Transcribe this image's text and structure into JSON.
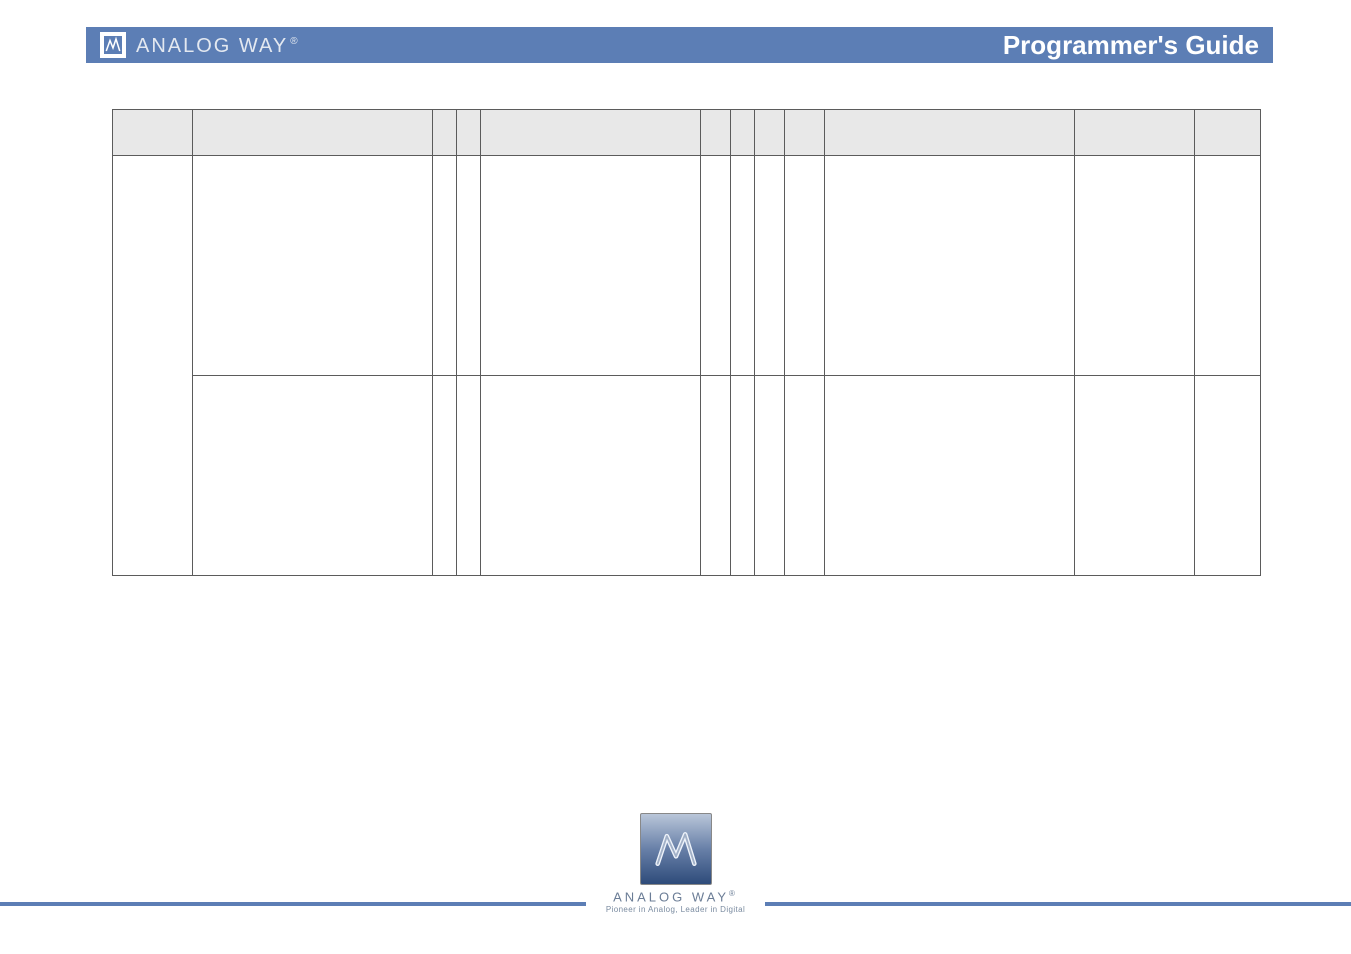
{
  "header": {
    "brand_text": "ANALOG WAY",
    "brand_reg": "®",
    "title": "Programmer's Guide"
  },
  "table": {
    "head": [
      "",
      "",
      "",
      "",
      "",
      "",
      "",
      "",
      "",
      "",
      "",
      ""
    ],
    "row1": [
      "",
      "",
      "",
      "",
      "",
      "",
      "",
      "",
      "",
      "",
      "",
      ""
    ],
    "row2_cells": [
      "",
      "",
      "",
      "",
      "",
      "",
      "",
      "",
      "",
      "",
      ""
    ]
  },
  "footer": {
    "brand": "ANALOG WAY",
    "brand_reg": "®",
    "tagline": "Pioneer in Analog, Leader in Digital"
  }
}
